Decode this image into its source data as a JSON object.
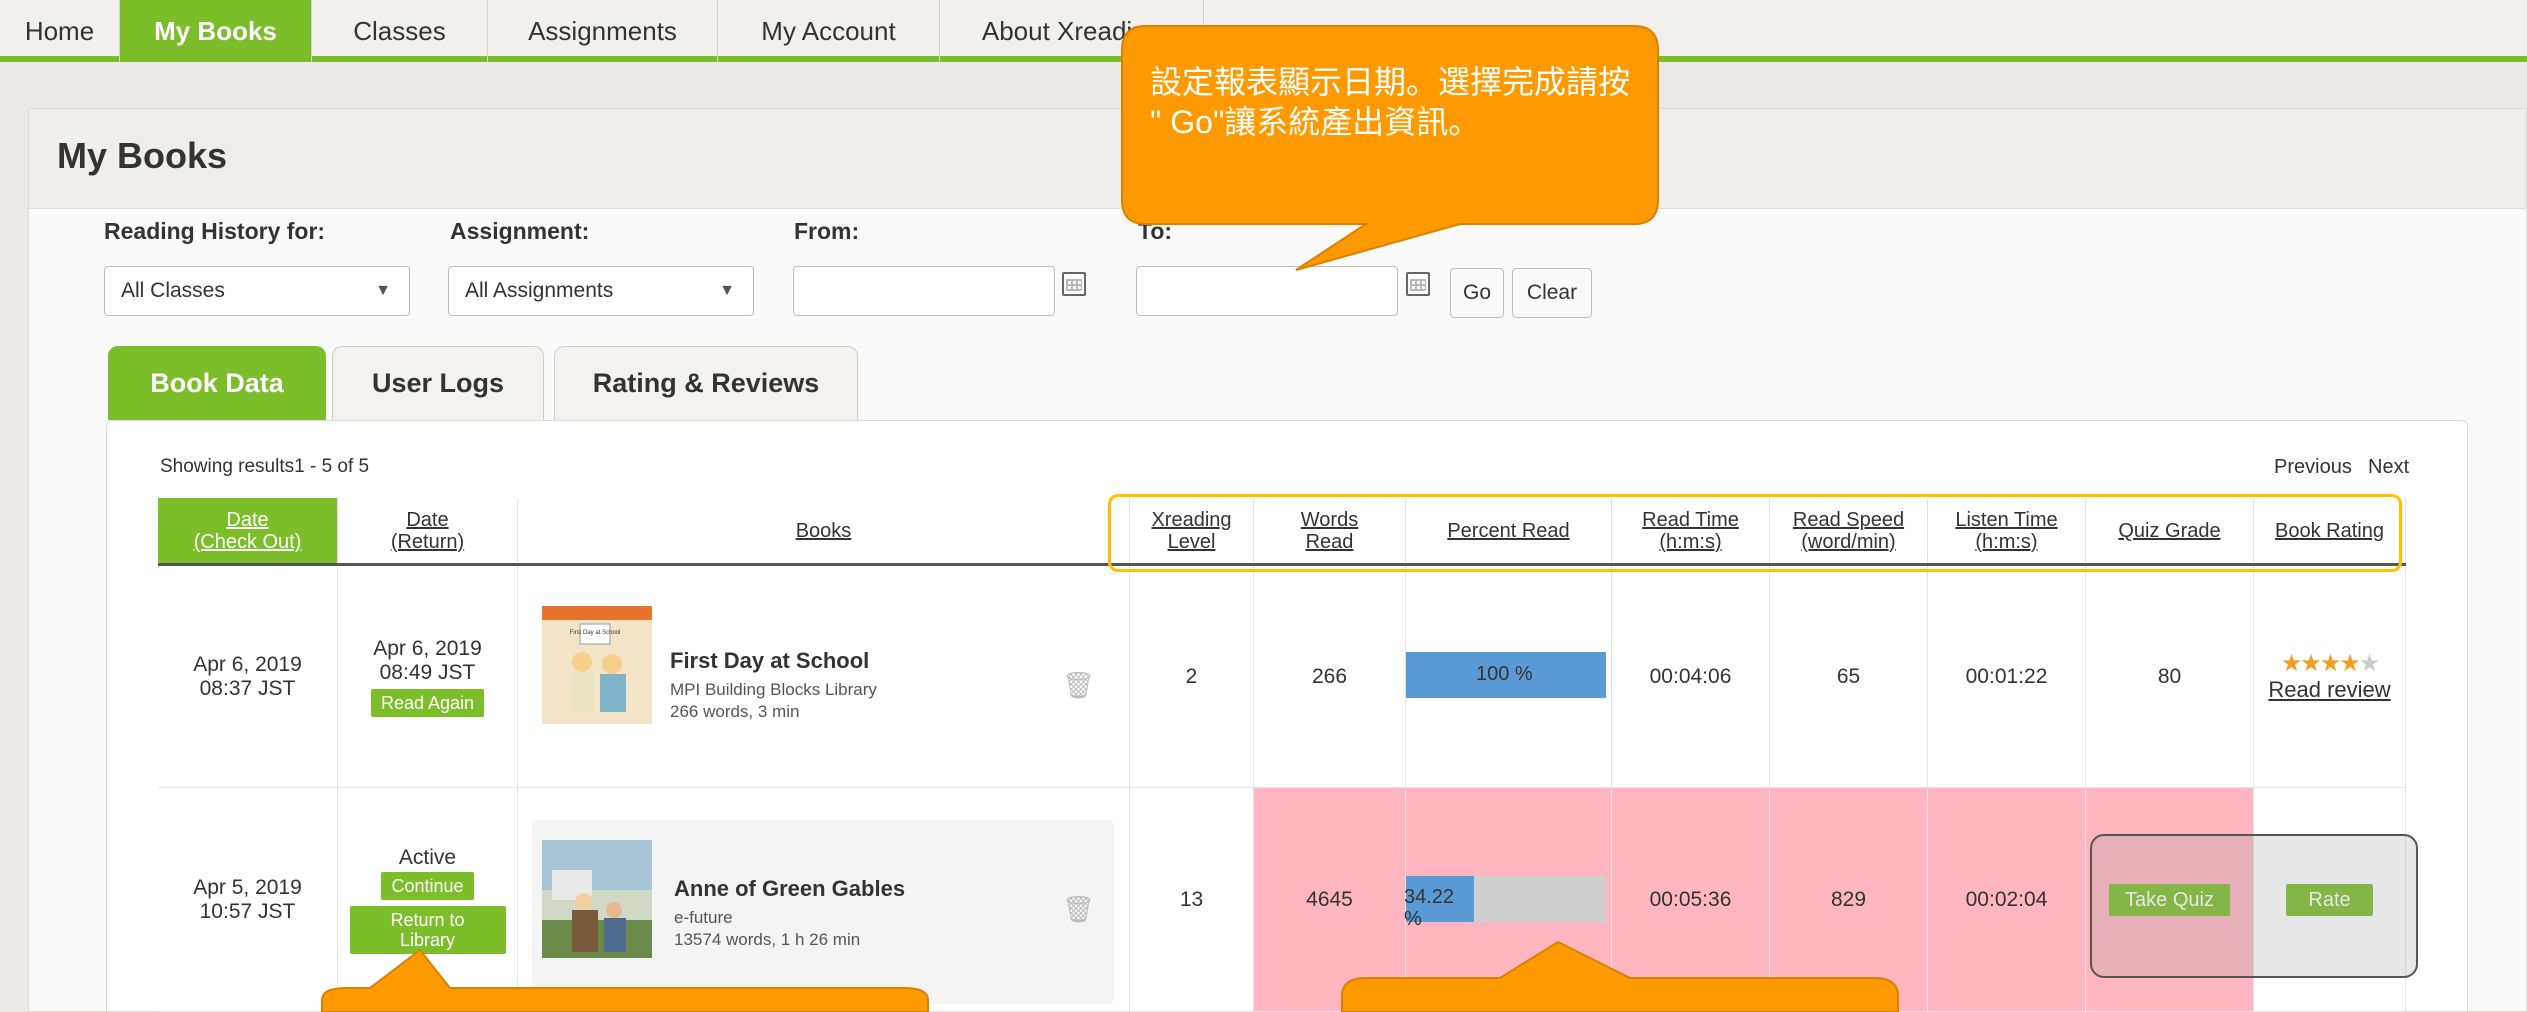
{
  "nav": {
    "items": [
      "Home",
      "My Books",
      "Classes",
      "Assignments",
      "My Account",
      "About Xreading"
    ]
  },
  "page": {
    "title": "My Books"
  },
  "filters": {
    "reading_history_label": "Reading History for:",
    "reading_history_value": "All Classes",
    "assignment_label": "Assignment:",
    "assignment_value": "All Assignments",
    "from_label": "From:",
    "to_label": "To:",
    "go_label": "Go",
    "clear_label": "Clear"
  },
  "tabs": [
    "Book Data",
    "User Logs",
    "Rating & Reviews"
  ],
  "results": {
    "showing": "Showing results1 - 5 of 5",
    "previous": "Previous",
    "next": "Next"
  },
  "table": {
    "headers": [
      "Date\n(Check Out)",
      "Date\n(Return)",
      "Books",
      "Xreading\nLevel",
      "Words\nRead",
      "Percent Read",
      "Read Time\n(h:m:s)",
      "Read Speed\n(word/min)",
      "Listen Time\n(h:m:s)",
      "Quiz Grade",
      "Book Rating"
    ],
    "rows": [
      {
        "checkout": "Apr 6, 2019\n08:37 JST",
        "return_date": "Apr 6, 2019\n08:49 JST",
        "action": "Read Again",
        "book_title": "First Day at School",
        "book_series": "MPI Building Blocks Library",
        "book_info": "266 words, 3 min",
        "cover_text": "First Day at School",
        "level": "2",
        "words": "266",
        "percent_label": "100 %",
        "percent": 100,
        "read_time": "00:04:06",
        "read_speed": "65",
        "listen_time": "00:01:22",
        "quiz_grade": "80",
        "rating_stars": 4,
        "rating_link": "Read review"
      },
      {
        "status": "Active",
        "continue_label": "Continue",
        "return_label": "Return to\nLibrary",
        "checkout": "Apr 5, 2019\n10:57 JST",
        "book_title": "Anne of Green Gables",
        "book_series": "e-future",
        "book_info": "13574 words, 1 h 26 min",
        "level": "13",
        "words": "4645",
        "percent_label": "34.22\n%",
        "percent": 34.22,
        "read_time": "00:05:36",
        "read_speed": "829",
        "listen_time": "00:02:04",
        "quiz_label": "Take Quiz",
        "rate_label": "Rate"
      }
    ]
  },
  "annotations": {
    "callout_top": "設定報表顯示日期。選擇完成請按 \" Go\"讓系統產出資訊。"
  },
  "colors": {
    "accent": "#7bbe2a",
    "callout": "#ff9900",
    "pink": "#ffb6c1",
    "bar": "#5b9bd5"
  }
}
